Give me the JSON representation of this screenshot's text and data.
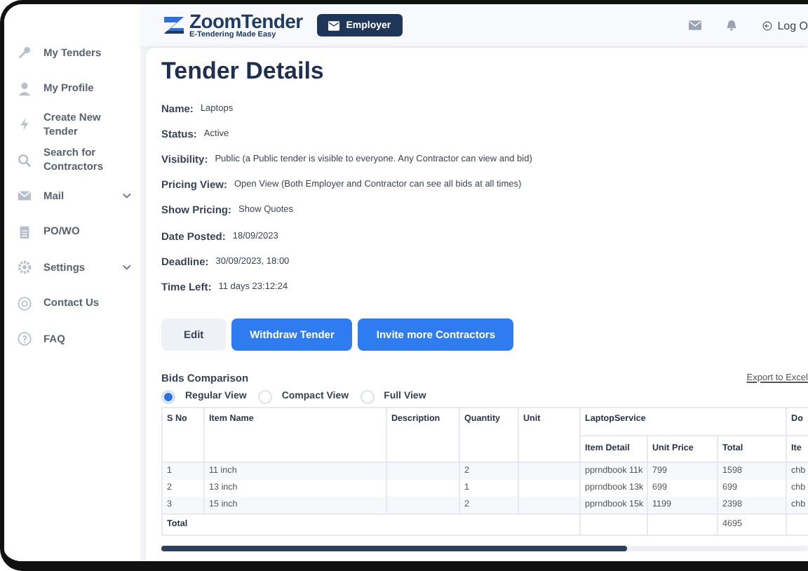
{
  "header": {
    "logo": {
      "name": "ZoomTender",
      "tagline": "E-Tendering Made Easy"
    },
    "role_button": "Employer",
    "logout": "Log O"
  },
  "sidebar": {
    "items": [
      {
        "label": "My Tenders",
        "has_submenu": false
      },
      {
        "label": "My Profile",
        "has_submenu": false
      },
      {
        "label": "Create New Tender",
        "has_submenu": false
      },
      {
        "label": "Search for Contractors",
        "has_submenu": false
      },
      {
        "label": "Mail",
        "has_submenu": true
      },
      {
        "label": "PO/WO",
        "has_submenu": false
      },
      {
        "label": "Settings",
        "has_submenu": true
      },
      {
        "label": "Contact Us",
        "has_submenu": false
      },
      {
        "label": "FAQ",
        "has_submenu": false
      }
    ]
  },
  "page": {
    "title": "Tender Details",
    "details": [
      {
        "label": "Name:",
        "value": "Laptops"
      },
      {
        "label": "Status:",
        "value": "Active"
      },
      {
        "label": "Visibility:",
        "value": "Public (a Public tender is visible to everyone. Any Contractor can view and bid)"
      },
      {
        "label": "Pricing View:",
        "value": "Open View (Both Employer and Contractor can see all bids at all times)"
      },
      {
        "label": "Show Pricing:",
        "value": "Show Quotes"
      },
      {
        "label": "Date Posted:",
        "value": "18/09/2023"
      },
      {
        "label": "Deadline:",
        "value": "30/09/2023, 18:00"
      },
      {
        "label": "Time Left:",
        "value": "11 days 23:12:24"
      }
    ],
    "buttons": [
      {
        "label": "Edit",
        "kind": "secondary"
      },
      {
        "label": "Withdraw Tender",
        "kind": "primary"
      },
      {
        "label": "Invite more Contractors",
        "kind": "primary"
      }
    ]
  },
  "bids": {
    "title": "Bids Comparison",
    "export_link": "Export to Excel",
    "views": [
      {
        "label": "Regular View",
        "selected": true
      },
      {
        "label": "Compact View",
        "selected": false
      },
      {
        "label": "Full View",
        "selected": false
      }
    ],
    "table": {
      "columns": [
        "S No",
        "Item Name",
        "Description",
        "Quantity",
        "Unit"
      ],
      "groups": [
        {
          "label": "LaptopService",
          "subcolumns": [
            "Item Detail",
            "Unit Price",
            "Total"
          ]
        },
        {
          "label": "Do",
          "subcolumns": [
            "Ite"
          ]
        }
      ],
      "rows": [
        {
          "s_no": "1",
          "item_name": "11 inch",
          "quantity": "2",
          "bids": [
            [
              "pprndbook 11k",
              "799",
              "1598"
            ],
            [
              "chb"
            ]
          ]
        },
        {
          "s_no": "2",
          "item_name": "13 inch",
          "quantity": "1",
          "bids": [
            [
              "pprndbook 13k",
              "699",
              "699"
            ],
            [
              "chb"
            ]
          ]
        },
        {
          "s_no": "3",
          "item_name": "15 inch",
          "quantity": "2",
          "bids": [
            [
              "pprndbook 15k",
              "1199",
              "2398"
            ],
            [
              "chb"
            ]
          ]
        }
      ],
      "total_row": {
        "label": "Total",
        "group_totals": [
          "4695"
        ]
      }
    }
  }
}
